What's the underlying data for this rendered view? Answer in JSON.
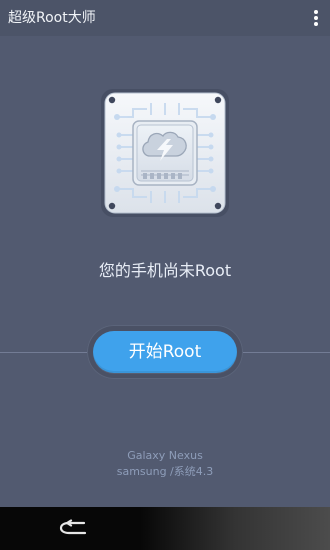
{
  "app": {
    "title": "超级Root大师"
  },
  "menu": {
    "icon": "more-vert-icon"
  },
  "status": {
    "text": "您的手机尚未Root"
  },
  "actions": {
    "start_label": "开始Root"
  },
  "device": {
    "model": "Galaxy Nexus",
    "vendor_os": "samsung /系统4.3"
  },
  "navigation": {
    "back_icon": "back-arrow-icon"
  },
  "colors": {
    "background": "#525a70",
    "accent": "#3fa2ec",
    "muted_text": "#8e9db9",
    "navbar": "#070707"
  }
}
